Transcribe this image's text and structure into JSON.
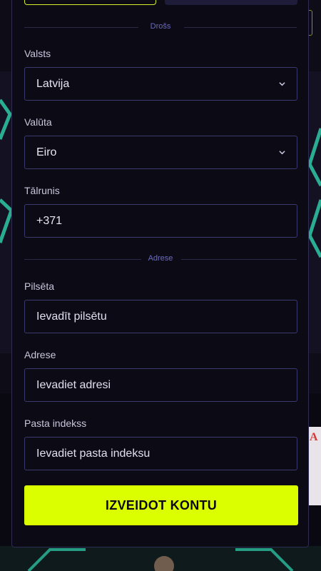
{
  "form": {
    "security_divider": "Drošs",
    "country": {
      "label": "Valsts",
      "value": "Latvija"
    },
    "currency": {
      "label": "Valūta",
      "value": "Eiro"
    },
    "phone": {
      "label": "Tālrunis",
      "value": "+371"
    },
    "address_divider": "Adrese",
    "city": {
      "label": "Pilsēta",
      "placeholder": "Ievadīt pilsētu"
    },
    "address": {
      "label": "Adrese",
      "placeholder": "Ievadiet adresi"
    },
    "postal": {
      "label": "Pasta indekss",
      "placeholder": "Ievadiet pasta indeksu"
    },
    "submit_label": "IZVEIDOT KONTU"
  },
  "colors": {
    "accent": "#dcff00",
    "field_border": "#3b3870",
    "divider_text": "#6b69c2",
    "modal_bg": "#0c0b15"
  }
}
